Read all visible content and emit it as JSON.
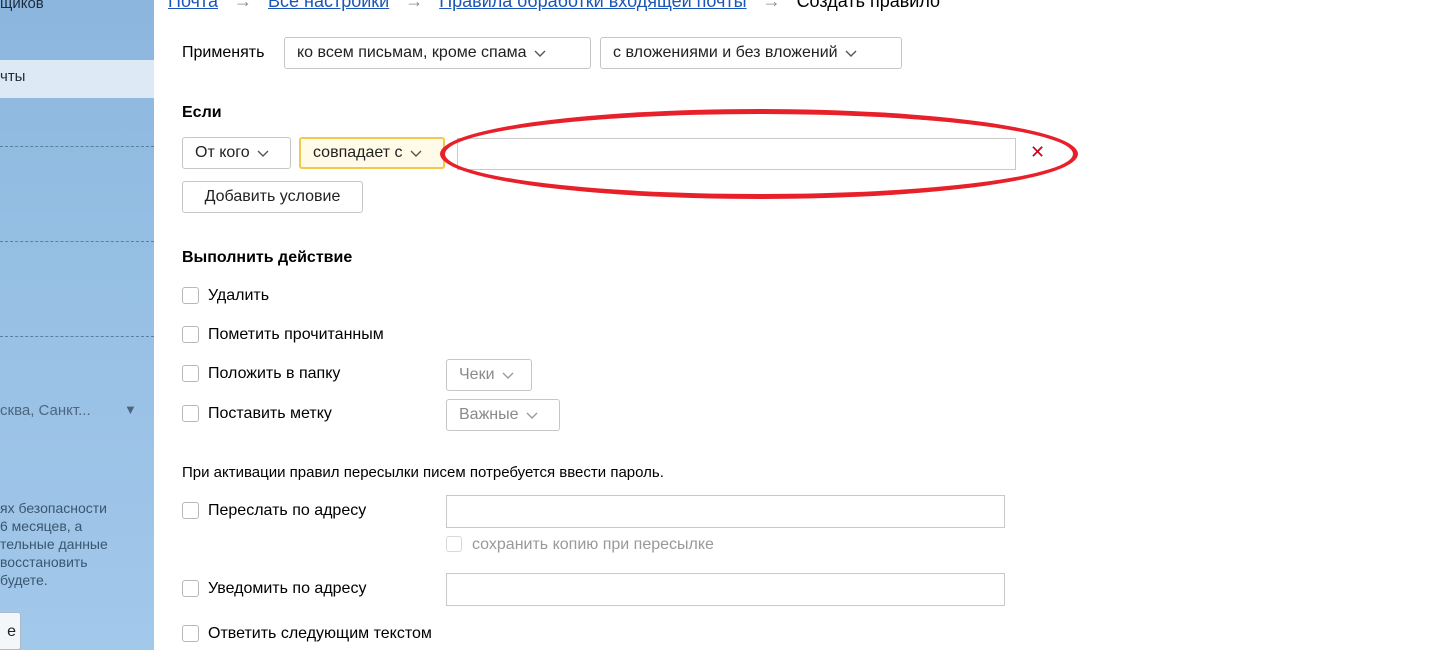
{
  "sidebar": {
    "item_top": "щиков",
    "item_selected": "чты",
    "region": "сква, Санкт...",
    "security_lines": [
      "ях безопасности",
      "6 месяцев, а",
      "тельные данные",
      "восстановить",
      "будете."
    ],
    "button_label": "е"
  },
  "breadcrumb": {
    "items": [
      "Почта",
      "Все настройки",
      "Правила обработки входящей почты"
    ],
    "separator": "→",
    "current": "Создать правило"
  },
  "apply": {
    "label": "Применять",
    "scope_value": "ко всем письмам, кроме спама",
    "attachments_value": "с вложениями и без вложений"
  },
  "condition": {
    "heading": "Если",
    "field_value": "От кого",
    "operator_value": "совпадает с",
    "value": "",
    "add_button": "Добавить условие"
  },
  "actions": {
    "heading": "Выполнить действие",
    "delete": "Удалить",
    "mark_read": "Пометить прочитанным",
    "move_folder": "Положить в папку",
    "folder_value": "Чеки",
    "set_label": "Поставить метку",
    "label_value": "Важные",
    "forward_note": "При активации правил пересылки писем потребуется ввести пароль.",
    "forward": "Переслать по адресу",
    "keep_copy": "сохранить копию при пересылке",
    "notify": "Уведомить по адресу",
    "reply": "Ответить следующим текстом"
  },
  "colors": {
    "link": "#1a55b8",
    "highlight": "#e8202a",
    "remove": "#d0021b",
    "operator_border": "#f2c94c"
  }
}
